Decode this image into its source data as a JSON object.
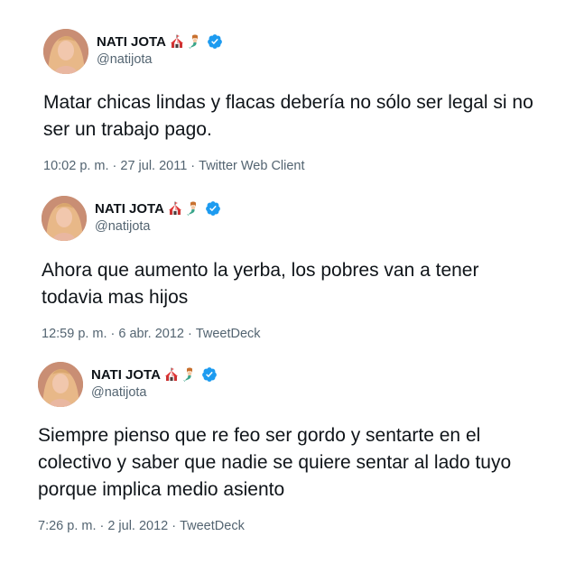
{
  "colors": {
    "name": "#0f1419",
    "secondary": "#536471",
    "verified": "#1d9bf0"
  },
  "tweets": [
    {
      "author": {
        "display_name": "NATI JOTA",
        "handle": "@natijota"
      },
      "icons": [
        "circus-tent-icon",
        "mermaid-icon",
        "verified-badge-icon"
      ],
      "text": "Matar chicas lindas y flacas debería no sólo ser legal si no ser un trabajo pago.",
      "time": "10:02 p. m.",
      "date": "27 jul. 2011",
      "source": "Twitter Web Client"
    },
    {
      "author": {
        "display_name": "NATI JOTA",
        "handle": "@natijota"
      },
      "icons": [
        "circus-tent-icon",
        "mermaid-icon",
        "verified-badge-icon"
      ],
      "text": "Ahora que aumento la yerba, los pobres van a tener todavia mas hijos",
      "time": "12:59 p. m.",
      "date": "6 abr. 2012",
      "source": "TweetDeck"
    },
    {
      "author": {
        "display_name": "NATI JOTA",
        "handle": "@natijota"
      },
      "icons": [
        "circus-tent-icon",
        "mermaid-icon",
        "verified-badge-icon"
      ],
      "text": "Siempre pienso que re feo ser gordo y sentarte en el colectivo y saber que nadie se quiere sentar al lado tuyo porque implica medio asiento",
      "time": "7:26 p. m.",
      "date": "2 jul. 2012",
      "source": "TweetDeck"
    }
  ]
}
